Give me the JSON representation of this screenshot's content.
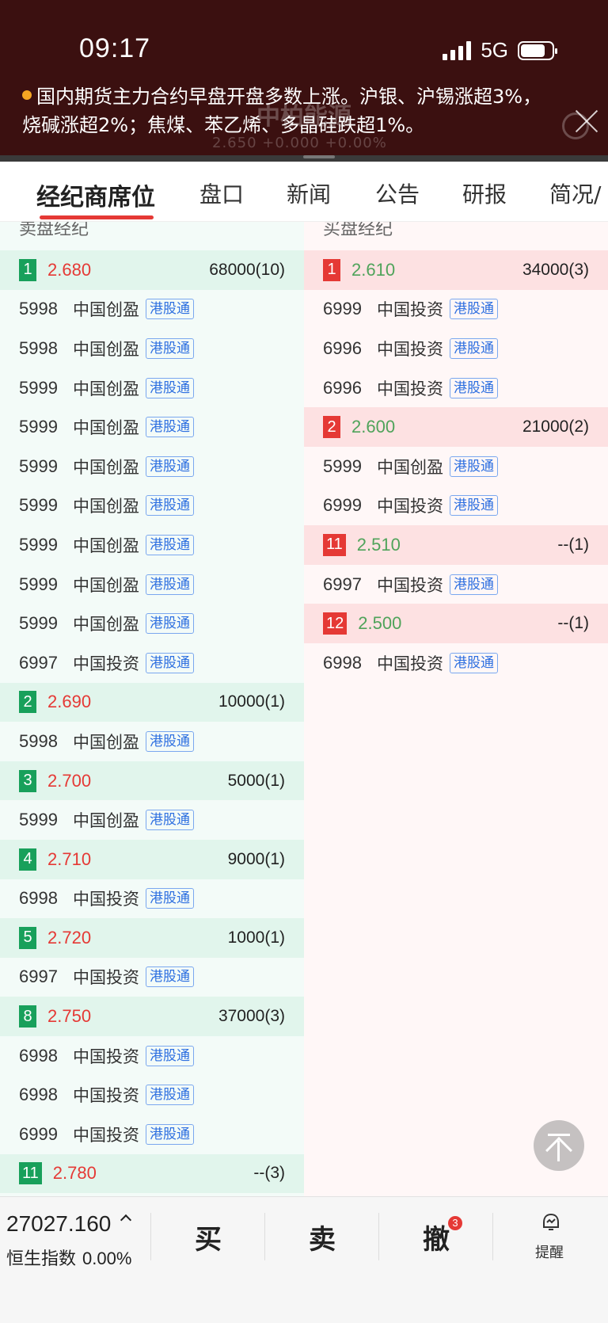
{
  "status_bar": {
    "time": "09:17",
    "network": "5G"
  },
  "header": {
    "ghost_title": "中柏能源",
    "ghost_quote": "2.650   +0.000   +0.00%",
    "news": "国内期货主力合约早盘开盘多数上涨。沪银、沪锡涨超3%，烧碱涨超2%；焦煤、苯乙烯、多晶硅跌超1%。"
  },
  "tabs": [
    "经纪商席位",
    "盘口",
    "新闻",
    "公告",
    "研报",
    "简况/"
  ],
  "columns": {
    "sell_header": "卖盘经纪",
    "buy_header": "买盘经纪"
  },
  "tag_label": "港股通",
  "sell_rows": [
    {
      "type": "level",
      "idx": "1",
      "price": "2.680",
      "vol": "68000(10)"
    },
    {
      "type": "broker",
      "code": "5998",
      "name": "中国创盈"
    },
    {
      "type": "broker",
      "code": "5998",
      "name": "中国创盈"
    },
    {
      "type": "broker",
      "code": "5999",
      "name": "中国创盈"
    },
    {
      "type": "broker",
      "code": "5999",
      "name": "中国创盈"
    },
    {
      "type": "broker",
      "code": "5999",
      "name": "中国创盈"
    },
    {
      "type": "broker",
      "code": "5999",
      "name": "中国创盈"
    },
    {
      "type": "broker",
      "code": "5999",
      "name": "中国创盈"
    },
    {
      "type": "broker",
      "code": "5999",
      "name": "中国创盈"
    },
    {
      "type": "broker",
      "code": "5999",
      "name": "中国创盈"
    },
    {
      "type": "broker",
      "code": "6997",
      "name": "中国投资"
    },
    {
      "type": "level",
      "idx": "2",
      "price": "2.690",
      "vol": "10000(1)"
    },
    {
      "type": "broker",
      "code": "5998",
      "name": "中国创盈"
    },
    {
      "type": "level",
      "idx": "3",
      "price": "2.700",
      "vol": "5000(1)"
    },
    {
      "type": "broker",
      "code": "5999",
      "name": "中国创盈"
    },
    {
      "type": "level",
      "idx": "4",
      "price": "2.710",
      "vol": "9000(1)"
    },
    {
      "type": "broker",
      "code": "6998",
      "name": "中国投资"
    },
    {
      "type": "level",
      "idx": "5",
      "price": "2.720",
      "vol": "1000(1)"
    },
    {
      "type": "broker",
      "code": "6997",
      "name": "中国投资"
    },
    {
      "type": "level",
      "idx": "8",
      "price": "2.750",
      "vol": "37000(3)"
    },
    {
      "type": "broker",
      "code": "6998",
      "name": "中国投资"
    },
    {
      "type": "broker",
      "code": "6998",
      "name": "中国投资"
    },
    {
      "type": "broker",
      "code": "6999",
      "name": "中国投资"
    },
    {
      "type": "level",
      "idx": "11",
      "price": "2.780",
      "vol": "--(3)"
    }
  ],
  "buy_rows": [
    {
      "type": "level",
      "idx": "1",
      "price": "2.610",
      "vol": "34000(3)"
    },
    {
      "type": "broker",
      "code": "6999",
      "name": "中国投资"
    },
    {
      "type": "broker",
      "code": "6996",
      "name": "中国投资"
    },
    {
      "type": "broker",
      "code": "6996",
      "name": "中国投资"
    },
    {
      "type": "level",
      "idx": "2",
      "price": "2.600",
      "vol": "21000(2)"
    },
    {
      "type": "broker",
      "code": "5999",
      "name": "中国创盈"
    },
    {
      "type": "broker",
      "code": "6999",
      "name": "中国投资"
    },
    {
      "type": "level",
      "idx": "11",
      "price": "2.510",
      "vol": "--(1)"
    },
    {
      "type": "broker",
      "code": "6997",
      "name": "中国投资"
    },
    {
      "type": "level",
      "idx": "12",
      "price": "2.500",
      "vol": "--(1)"
    },
    {
      "type": "broker",
      "code": "6998",
      "name": "中国投资"
    }
  ],
  "bottom": {
    "index_value": "27027.160",
    "index_name": "恒生指数",
    "index_change": "0.00%",
    "buy_label": "买",
    "sell_label": "卖",
    "cancel_label": "撤",
    "cancel_badge": "3",
    "remind_label": "提醒"
  },
  "colors": {
    "sell_bg": "#f3fbf8",
    "buy_bg": "#fff7f7",
    "sell_level": "#e1f5ec",
    "buy_level": "#fde1e2",
    "accent": "#e53935"
  }
}
